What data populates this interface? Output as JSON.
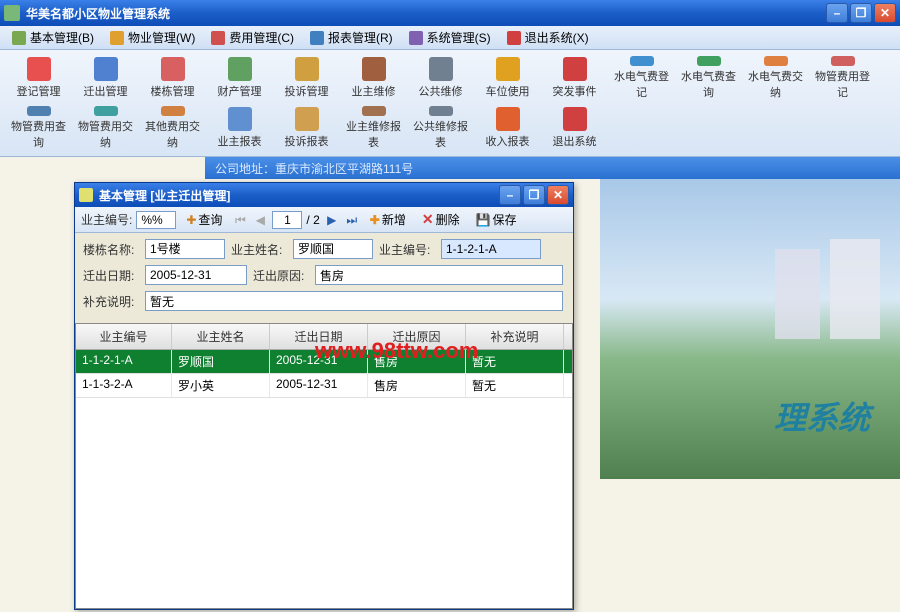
{
  "app": {
    "title": "华美名都小区物业管理系统"
  },
  "menu": [
    {
      "label": "基本管理(B)",
      "color": "#7aa850"
    },
    {
      "label": "物业管理(W)",
      "color": "#e0a030"
    },
    {
      "label": "费用管理(C)",
      "color": "#d05050"
    },
    {
      "label": "报表管理(R)",
      "color": "#4080c0"
    },
    {
      "label": "系统管理(S)",
      "color": "#8060b0"
    },
    {
      "label": "退出系统(X)",
      "color": "#d04040"
    }
  ],
  "tools_row1": [
    {
      "label": "登记管理",
      "color": "#e85050"
    },
    {
      "label": "迁出管理",
      "color": "#5080d0"
    },
    {
      "label": "楼栋管理",
      "color": "#d86060"
    },
    {
      "label": "财产管理",
      "color": "#60a060"
    },
    {
      "label": "投诉管理",
      "color": "#d0a040"
    },
    {
      "label": "业主维修",
      "color": "#a06040"
    },
    {
      "label": "公共维修",
      "color": "#708090"
    },
    {
      "label": "车位使用",
      "color": "#e0a020"
    },
    {
      "label": "突发事件",
      "color": "#d04040"
    },
    {
      "label": "水电气费登记",
      "color": "#4090d0"
    },
    {
      "label": "水电气费查询",
      "color": "#40a060"
    },
    {
      "label": "水电气费交纳",
      "color": "#e08040"
    },
    {
      "label": "物管费用登记",
      "color": "#d06060"
    },
    {
      "label": "物管费用查询",
      "color": "#5080b0"
    }
  ],
  "tools_row2": [
    {
      "label": "物管费用交纳",
      "color": "#40a0a0"
    },
    {
      "label": "其他费用交纳",
      "color": "#d08040"
    },
    {
      "label": "业主报表",
      "color": "#6090d0"
    },
    {
      "label": "投诉报表",
      "color": "#d0a050"
    },
    {
      "label": "业主维修报表",
      "color": "#a07050"
    },
    {
      "label": "公共维修报表",
      "color": "#708090"
    },
    {
      "label": "收入报表",
      "color": "#e06030"
    },
    {
      "label": "退出系统",
      "color": "#d04040"
    }
  ],
  "address": "公司地址：重庆市渝北区平湖路111号",
  "bg_text": "理系统",
  "sub": {
    "title": "基本管理 [业主迁出管理]",
    "search_label": "业主编号:",
    "search_value": "%%",
    "search_btn": "查询",
    "page_cur": "1",
    "page_total": "/ 2",
    "add_btn": "新增",
    "del_btn": "删除",
    "save_btn": "保存",
    "form": {
      "building_label": "楼栋名称:",
      "building_value": "1号楼",
      "name_label": "业主姓名:",
      "name_value": "罗顺国",
      "id_label": "业主编号:",
      "id_value": "1-1-2-1-A",
      "date_label": "迁出日期:",
      "date_value": "2005-12-31",
      "reason_label": "迁出原因:",
      "reason_value": "售房",
      "note_label": "补充说明:",
      "note_value": "暂无"
    },
    "grid_headers": [
      "业主编号",
      "业主姓名",
      "迁出日期",
      "迁出原因",
      "补充说明"
    ],
    "grid_rows": [
      {
        "selected": true,
        "cells": [
          "1-1-2-1-A",
          "罗顺国",
          "2005-12-31",
          "售房",
          "暂无"
        ]
      },
      {
        "selected": false,
        "cells": [
          "1-1-3-2-A",
          "罗小英",
          "2005-12-31",
          "售房",
          "暂无"
        ]
      }
    ]
  },
  "watermark": "www.98ttw.com"
}
